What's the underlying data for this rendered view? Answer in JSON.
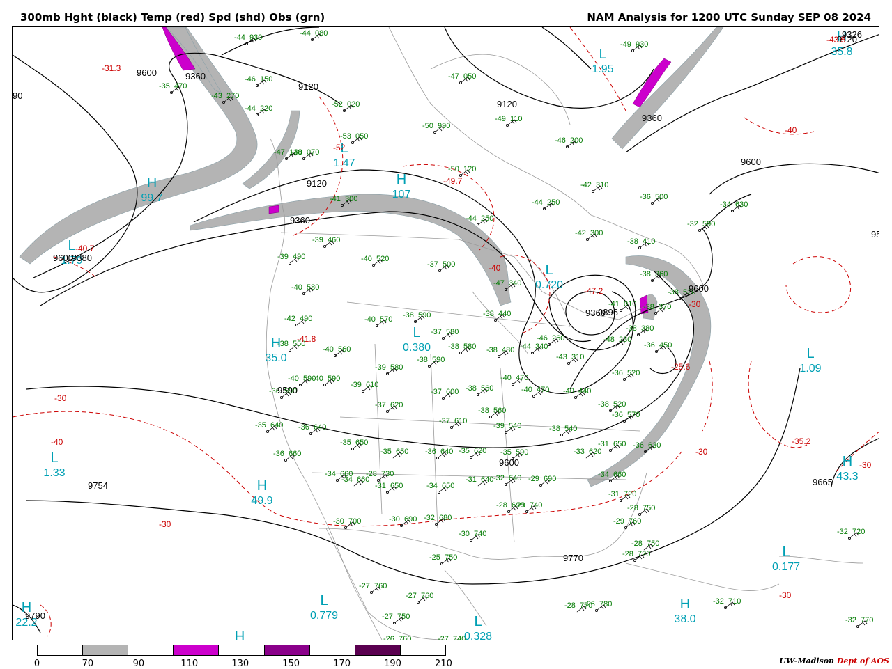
{
  "title_left": "300mb Hght (black) Temp (red) Spd (shd) Obs (grn)",
  "title_right": "NAM Analysis for 1200 UTC Sunday  SEP 08 2024",
  "credit": {
    "org": "UW-Madison",
    "dept": "Dept of AOS"
  },
  "colors": {
    "height": "#000000",
    "temp": "#cc0000",
    "obs": "#007a00",
    "speed_center": "#00a0b4",
    "borders": "#9a9a9a",
    "shade_70": "#b4b4b4",
    "shade_110": "#cc00cc",
    "shade_150": "#8a008a",
    "shade_190": "#5a0050"
  },
  "colorbar": {
    "labels": [
      "0",
      "70",
      "90",
      "110",
      "130",
      "150",
      "170",
      "190",
      "210"
    ],
    "segments": [
      "#ffffff",
      "#b4b4b4",
      "#ffffff",
      "#cc00cc",
      "#ffffff",
      "#8a008a",
      "#ffffff",
      "#5a0050",
      "#ffffff"
    ]
  },
  "height_labels": [
    "9600",
    "9360",
    "9120",
    "9120",
    "9120",
    "9360",
    "9600",
    "9600",
    "9360",
    "9600",
    "9380",
    "9120",
    "9360",
    "9590",
    "9600",
    "9754",
    "9770",
    "9665",
    "9790",
    "9326",
    "90",
    "95",
    "9896"
  ],
  "temp_labels": [
    "-31.3",
    "-40.7",
    "-49.7",
    "-52",
    "-40",
    "-47.2",
    "-41.8",
    "-30",
    "-30",
    "-30",
    "-30",
    "-35.2",
    "-25.6",
    "-43.5",
    "-40",
    "-30",
    "-40",
    "-30"
  ],
  "highs_lows": [
    {
      "type": "H",
      "value": "99.7"
    },
    {
      "type": "H",
      "value": "49.9"
    },
    {
      "type": "H",
      "value": "43.3"
    },
    {
      "type": "H",
      "value": "35.8"
    },
    {
      "type": "H",
      "value": "107"
    },
    {
      "type": "H",
      "value": "22.2"
    },
    {
      "type": "H",
      "value": "35.0"
    },
    {
      "type": "H",
      "value": "38.0"
    },
    {
      "type": "H",
      "value": ""
    },
    {
      "type": "L",
      "value": "1.33"
    },
    {
      "type": "L",
      "value": "1.47"
    },
    {
      "type": "L",
      "value": "0.720"
    },
    {
      "type": "L",
      "value": "0.380"
    },
    {
      "type": "L",
      "value": "1.79"
    },
    {
      "type": "L",
      "value": "1.09"
    },
    {
      "type": "L",
      "value": "0.779"
    },
    {
      "type": "L",
      "value": "0.177"
    },
    {
      "type": "L",
      "value": "0.328"
    },
    {
      "type": "L",
      "value": "1.95"
    }
  ],
  "obs": [
    {
      "t": "-44",
      "h": "930"
    },
    {
      "t": "-44",
      "h": "080"
    },
    {
      "t": "-49",
      "h": "930"
    },
    {
      "t": "-35",
      "h": "470"
    },
    {
      "t": "-46",
      "h": "150"
    },
    {
      "t": "-47",
      "h": "050"
    },
    {
      "t": "-43",
      "h": "270"
    },
    {
      "t": "-44",
      "h": "220"
    },
    {
      "t": "-52",
      "h": "020"
    },
    {
      "t": "-50",
      "h": "990"
    },
    {
      "t": "-49",
      "h": "110"
    },
    {
      "t": "-53",
      "h": "050"
    },
    {
      "t": "-46",
      "h": "200"
    },
    {
      "t": "-47",
      "h": "130"
    },
    {
      "t": "-48",
      "h": "070"
    },
    {
      "t": "-50",
      "h": "120"
    },
    {
      "t": "-42",
      "h": "310"
    },
    {
      "t": "-36",
      "h": "500"
    },
    {
      "t": "-34",
      "h": "630"
    },
    {
      "t": "-44",
      "h": "250"
    },
    {
      "t": "-41",
      "h": "300"
    },
    {
      "t": "-44",
      "h": "250"
    },
    {
      "t": "-32",
      "h": "590"
    },
    {
      "t": "-42",
      "h": "300"
    },
    {
      "t": "-38",
      "h": "410"
    },
    {
      "t": "-39",
      "h": "460"
    },
    {
      "t": "-39",
      "h": "490"
    },
    {
      "t": "-40",
      "h": "520"
    },
    {
      "t": "-37",
      "h": "500"
    },
    {
      "t": "-47",
      "h": "340"
    },
    {
      "t": "-38",
      "h": "360"
    },
    {
      "t": "-38",
      "h": "520"
    },
    {
      "t": "-40",
      "h": "580"
    },
    {
      "t": "-41",
      "h": "010"
    },
    {
      "t": "-38",
      "h": "370"
    },
    {
      "t": "-42",
      "h": "490"
    },
    {
      "t": "-40",
      "h": "570"
    },
    {
      "t": "-38",
      "h": "590"
    },
    {
      "t": "-37",
      "h": "580"
    },
    {
      "t": "-38",
      "h": "440"
    },
    {
      "t": "-38",
      "h": "550"
    },
    {
      "t": "-40",
      "h": "560"
    },
    {
      "t": "-38",
      "h": "580"
    },
    {
      "t": "-38",
      "h": "480"
    },
    {
      "t": "-44",
      "h": "340"
    },
    {
      "t": "-46",
      "h": "260"
    },
    {
      "t": "-48",
      "h": "230"
    },
    {
      "t": "-36",
      "h": "450"
    },
    {
      "t": "-38",
      "h": "380"
    },
    {
      "t": "-38",
      "h": "590"
    },
    {
      "t": "-39",
      "h": "580"
    },
    {
      "t": "-43",
      "h": "310"
    },
    {
      "t": "-40",
      "h": "590"
    },
    {
      "t": "-36",
      "h": "590"
    },
    {
      "t": "-40",
      "h": "590"
    },
    {
      "t": "-39",
      "h": "610"
    },
    {
      "t": "-40",
      "h": "470"
    },
    {
      "t": "-37",
      "h": "600"
    },
    {
      "t": "-38",
      "h": "560"
    },
    {
      "t": "-40",
      "h": "470"
    },
    {
      "t": "-40",
      "h": "440"
    },
    {
      "t": "-36",
      "h": "520"
    },
    {
      "t": "-37",
      "h": "620"
    },
    {
      "t": "-38",
      "h": "520"
    },
    {
      "t": "-36",
      "h": "570"
    },
    {
      "t": "-37",
      "h": "610"
    },
    {
      "t": "-38",
      "h": "560"
    },
    {
      "t": "-39",
      "h": "540"
    },
    {
      "t": "-38",
      "h": "540"
    },
    {
      "t": "-35",
      "h": "640"
    },
    {
      "t": "-36",
      "h": "640"
    },
    {
      "t": "-35",
      "h": "650"
    },
    {
      "t": "-35",
      "h": "650"
    },
    {
      "t": "-36",
      "h": "640"
    },
    {
      "t": "-35",
      "h": "620"
    },
    {
      "t": "-33",
      "h": "620"
    },
    {
      "t": "-35",
      "h": "590"
    },
    {
      "t": "-36",
      "h": "630"
    },
    {
      "t": "-36",
      "h": "660"
    },
    {
      "t": "-34",
      "h": "660"
    },
    {
      "t": "-31",
      "h": "650"
    },
    {
      "t": "-34",
      "h": "650"
    },
    {
      "t": "-31",
      "h": "640"
    },
    {
      "t": "-32",
      "h": "640"
    },
    {
      "t": "-29",
      "h": "690"
    },
    {
      "t": "-34",
      "h": "660"
    },
    {
      "t": "-34",
      "h": "660"
    },
    {
      "t": "-28",
      "h": "730"
    },
    {
      "t": "-31",
      "h": "720"
    },
    {
      "t": "-30",
      "h": "700"
    },
    {
      "t": "-30",
      "h": "690"
    },
    {
      "t": "-32",
      "h": "680"
    },
    {
      "t": "-28",
      "h": "690"
    },
    {
      "t": "-29",
      "h": "740"
    },
    {
      "t": "-29",
      "h": "760"
    },
    {
      "t": "-28",
      "h": "720"
    },
    {
      "t": "-30",
      "h": "740"
    },
    {
      "t": "-28",
      "h": "750"
    },
    {
      "t": "-28",
      "h": "750"
    },
    {
      "t": "-25",
      "h": "750"
    },
    {
      "t": "-32",
      "h": "720"
    },
    {
      "t": "-27",
      "h": "760"
    },
    {
      "t": "-27",
      "h": "760"
    },
    {
      "t": "-27",
      "h": "750"
    },
    {
      "t": "-28",
      "h": "770"
    },
    {
      "t": "-26",
      "h": "780"
    },
    {
      "t": "-32",
      "h": "710"
    },
    {
      "t": "-26",
      "h": "760"
    },
    {
      "t": "-27",
      "h": "740"
    },
    {
      "t": "-32",
      "h": "770"
    },
    {
      "t": "-31",
      "h": "650"
    }
  ]
}
